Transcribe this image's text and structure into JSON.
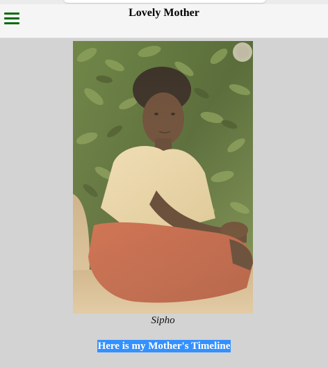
{
  "header": {
    "title": "Lovely Mother",
    "menu_icon": "hamburger-menu-icon"
  },
  "photo": {
    "caption": "Sipho"
  },
  "timeline_link": {
    "label": "Here is my Mother's Timeline",
    "highlight_color": "#3390ff"
  },
  "colors": {
    "page_background": "#d3d3d3",
    "header_background": "#f5f5f5",
    "menu_icon": "#0b6b0b"
  }
}
